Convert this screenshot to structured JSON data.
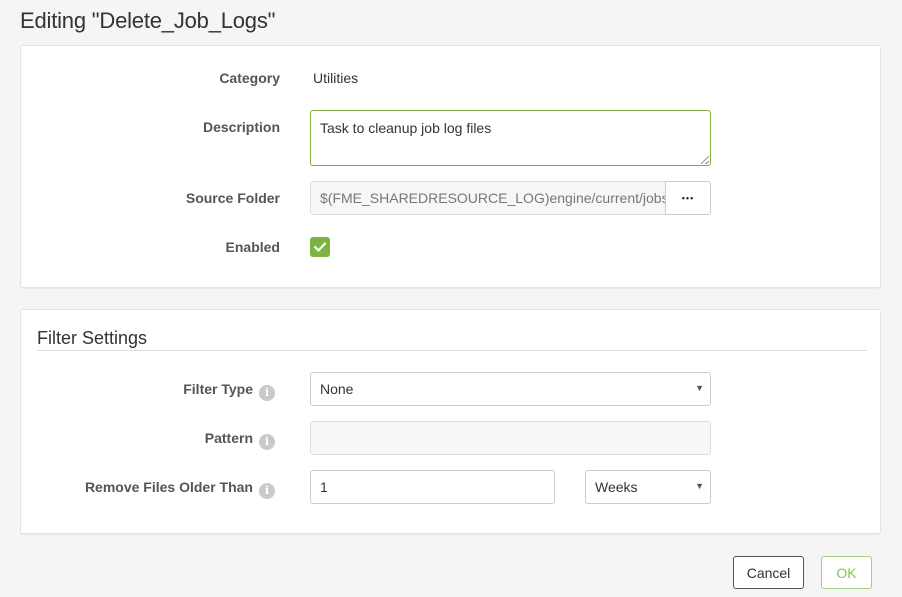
{
  "page": {
    "title": "Editing \"Delete_Job_Logs\""
  },
  "general": {
    "category_label": "Category",
    "category_value": "Utilities",
    "description_label": "Description",
    "description_value": "Task to cleanup job log files",
    "source_folder_label": "Source Folder",
    "source_folder_value": "$(FME_SHAREDRESOURCE_LOG)engine/current/jobs",
    "browse_label": "•••",
    "enabled_label": "Enabled",
    "enabled_checked": true
  },
  "filter": {
    "section_title": "Filter Settings",
    "filter_type_label": "Filter Type",
    "filter_type_value": "None",
    "pattern_label": "Pattern",
    "pattern_value": "",
    "remove_older_label": "Remove Files Older Than",
    "remove_older_value": "1",
    "unit_value": "Weeks",
    "info_glyph": "i"
  },
  "actions": {
    "cancel_label": "Cancel",
    "ok_label": "OK"
  },
  "colors": {
    "accent_green": "#7cb342",
    "ok_text": "#8bc34a"
  }
}
